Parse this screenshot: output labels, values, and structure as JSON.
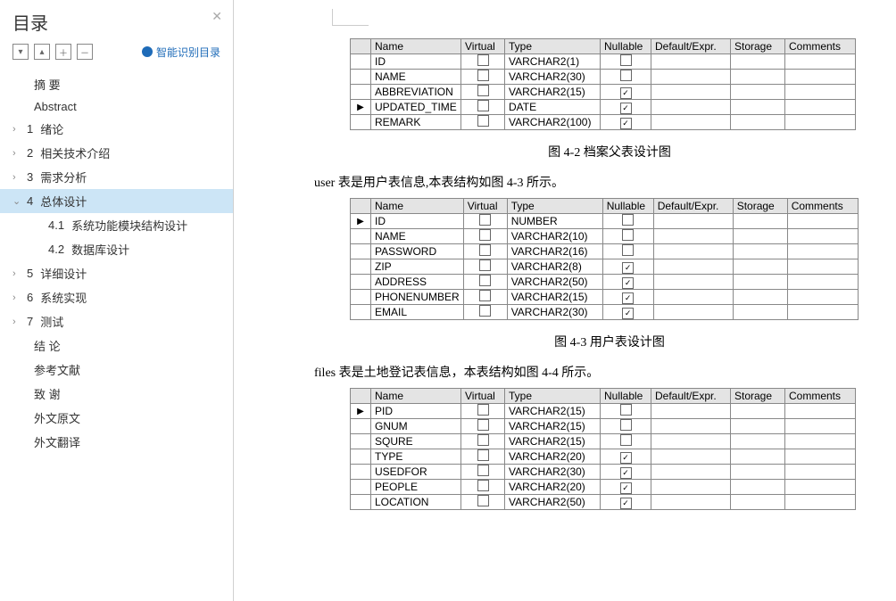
{
  "sidebar": {
    "title": "目录",
    "smart_link": "智能识别目录",
    "toolbar_icons": [
      "▾",
      "▴",
      "＋",
      "－"
    ],
    "items": [
      {
        "label": "摘  要",
        "level": "l0",
        "num": "",
        "chev": ""
      },
      {
        "label": "Abstract",
        "level": "l0",
        "num": "",
        "chev": ""
      },
      {
        "label": "绪论",
        "level": "l1",
        "num": "1",
        "chev": "›"
      },
      {
        "label": "相关技术介绍",
        "level": "l1",
        "num": "2",
        "chev": "›"
      },
      {
        "label": "需求分析",
        "level": "l1",
        "num": "3",
        "chev": "›"
      },
      {
        "label": "总体设计",
        "level": "l1",
        "num": "4",
        "chev": "⌄",
        "selected": true
      },
      {
        "label": "系统功能模块结构设计",
        "level": "l2",
        "num": "4.1",
        "chev": ""
      },
      {
        "label": "数据库设计",
        "level": "l2",
        "num": "4.2",
        "chev": ""
      },
      {
        "label": "详细设计",
        "level": "l1",
        "num": "5",
        "chev": "›"
      },
      {
        "label": "系统实现",
        "level": "l1",
        "num": "6",
        "chev": "›"
      },
      {
        "label": "测试",
        "level": "l1",
        "num": "7",
        "chev": "›"
      },
      {
        "label": "结  论",
        "level": "l0",
        "num": "",
        "chev": ""
      },
      {
        "label": "参考文献",
        "level": "l0",
        "num": "",
        "chev": ""
      },
      {
        "label": "致  谢",
        "level": "l0",
        "num": "",
        "chev": ""
      },
      {
        "label": "外文原文",
        "level": "l0",
        "num": "",
        "chev": ""
      },
      {
        "label": "外文翻译",
        "level": "l0",
        "num": "",
        "chev": ""
      }
    ]
  },
  "headers": {
    "name": "Name",
    "virtual": "Virtual",
    "type": "Type",
    "nullable": "Nullable",
    "default": "Default/Expr.",
    "storage": "Storage",
    "comments": "Comments"
  },
  "table1": {
    "caption": "图 4-2 档案父表设计图",
    "rows": [
      {
        "marker": "",
        "name": "ID",
        "type": "VARCHAR2(1)",
        "nullable": false
      },
      {
        "marker": "",
        "name": "NAME",
        "type": "VARCHAR2(30)",
        "nullable": false
      },
      {
        "marker": "",
        "name": "ABBREVIATION",
        "type": "VARCHAR2(15)",
        "nullable": true
      },
      {
        "marker": "▶",
        "name": "UPDATED_TIME",
        "type": "DATE",
        "nullable": true,
        "def_dotted": true
      },
      {
        "marker": "",
        "name": "REMARK",
        "type": "VARCHAR2(100)",
        "nullable": true
      }
    ]
  },
  "para2": "user 表是用户表信息,本表结构如图 4-3 所示。",
  "table2": {
    "caption": "图 4-3 用户表设计图",
    "rows": [
      {
        "marker": "▶",
        "name": "ID",
        "type": "NUMBER",
        "nullable": false,
        "dotted": true
      },
      {
        "marker": "",
        "name": "NAME",
        "type": "VARCHAR2(10)",
        "nullable": false
      },
      {
        "marker": "",
        "name": "PASSWORD",
        "type": "VARCHAR2(16)",
        "nullable": false
      },
      {
        "marker": "",
        "name": "ZIP",
        "type": "VARCHAR2(8)",
        "nullable": true
      },
      {
        "marker": "",
        "name": "ADDRESS",
        "type": "VARCHAR2(50)",
        "nullable": true
      },
      {
        "marker": "",
        "name": "PHONENUMBER",
        "type": "VARCHAR2(15)",
        "nullable": true
      },
      {
        "marker": "",
        "name": "EMAIL",
        "type": "VARCHAR2(30)",
        "nullable": true
      }
    ]
  },
  "para3": "files 表是土地登记表信息，本表结构如图 4-4 所示。",
  "table3": {
    "rows": [
      {
        "marker": "▶",
        "name": "PID",
        "type": "VARCHAR2(15)",
        "nullable": false,
        "dotted": true
      },
      {
        "marker": "",
        "name": "GNUM",
        "type": "VARCHAR2(15)",
        "nullable": false
      },
      {
        "marker": "",
        "name": "SQURE",
        "type": "VARCHAR2(15)",
        "nullable": false
      },
      {
        "marker": "",
        "name": "TYPE",
        "type": "VARCHAR2(20)",
        "nullable": true
      },
      {
        "marker": "",
        "name": "USEDFOR",
        "type": "VARCHAR2(30)",
        "nullable": true
      },
      {
        "marker": "",
        "name": "PEOPLE",
        "type": "VARCHAR2(20)",
        "nullable": true
      },
      {
        "marker": "",
        "name": "LOCATION",
        "type": "VARCHAR2(50)",
        "nullable": true
      }
    ]
  }
}
